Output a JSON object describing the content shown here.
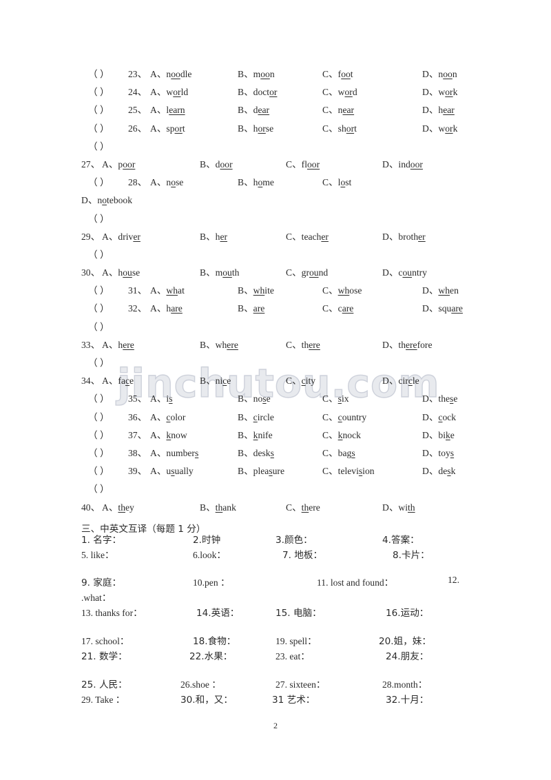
{
  "document": {
    "page_number": "2",
    "watermark": "jinchutou.com"
  },
  "multiple_choice": {
    "rows": [
      {
        "paren": "（      ）",
        "number": "23、",
        "options": [
          {
            "label": "A、",
            "pre": "n",
            "mark": "oo",
            "post": "dle"
          },
          {
            "label": "B、",
            "pre": "m",
            "mark": "oo",
            "post": "n"
          },
          {
            "label": "C、",
            "pre": "f",
            "mark": "oo",
            "post": "t"
          },
          {
            "label": "D、",
            "pre": "n",
            "mark": "oo",
            "post": "n"
          }
        ]
      },
      {
        "paren": "（      ）",
        "number": "24、",
        "options": [
          {
            "label": "A、",
            "pre": "w",
            "mark": "or",
            "post": "ld"
          },
          {
            "label": "B、",
            "pre": "doct",
            "mark": "or",
            "post": ""
          },
          {
            "label": "C、",
            "pre": "w",
            "mark": "or",
            "post": "d"
          },
          {
            "label": "D、",
            "pre": "w",
            "mark": "or",
            "post": "k"
          }
        ]
      },
      {
        "paren": "（      ）",
        "number": "25、",
        "options": [
          {
            "label": "A、",
            "pre": "l",
            "mark": "earn",
            "post": ""
          },
          {
            "label": "B、",
            "pre": "d",
            "mark": "ear",
            "post": ""
          },
          {
            "label": "C、",
            "pre": "n",
            "mark": "ear",
            "post": ""
          },
          {
            "label": "D、",
            "pre": "h",
            "mark": "ear",
            "post": ""
          }
        ]
      },
      {
        "paren": "（      ）",
        "number": "26、",
        "options": [
          {
            "label": "A、",
            "pre": "sp",
            "mark": "or",
            "post": "t"
          },
          {
            "label": "B、",
            "pre": "h",
            "mark": "or",
            "post": "se"
          },
          {
            "label": "C、",
            "pre": "sh",
            "mark": "or",
            "post": "t"
          },
          {
            "label": "D、",
            "pre": "w",
            "mark": "or",
            "post": "k"
          }
        ]
      },
      {
        "paren": "（      ）",
        "number": "27、",
        "wrap_paren": true,
        "options": [
          {
            "label": "A、",
            "pre": "p",
            "mark": "oor",
            "post": ""
          },
          {
            "label": "B、",
            "pre": "d",
            "mark": "oor",
            "post": ""
          },
          {
            "label": "C、",
            "pre": "fl",
            "mark": "oor",
            "post": ""
          },
          {
            "label": "D、",
            "pre": "ind",
            "mark": "oor",
            "post": ""
          }
        ]
      },
      {
        "paren": "（      ）",
        "number": "28、",
        "options": [
          {
            "label": "A、",
            "pre": "n",
            "mark": "o",
            "post": "se"
          },
          {
            "label": "B、",
            "pre": "h",
            "mark": "o",
            "post": "me"
          },
          {
            "label": "C、",
            "pre": "l",
            "mark": "o",
            "post": "st"
          },
          {
            "label": "D、",
            "pre": "n",
            "mark": "o",
            "post": "tebook"
          }
        ]
      },
      {
        "paren": "（      ）",
        "number": "29、",
        "wrap_paren": true,
        "options": [
          {
            "label": "A、",
            "pre": "driv",
            "mark": "er",
            "post": ""
          },
          {
            "label": "B、",
            "pre": "h",
            "mark": "er",
            "post": ""
          },
          {
            "label": "C、",
            "pre": "teach",
            "mark": "er",
            "post": ""
          },
          {
            "label": "D、",
            "pre": "broth",
            "mark": "er",
            "post": ""
          }
        ]
      },
      {
        "paren": "（      ）",
        "number": "30、",
        "wrap_paren": true,
        "options": [
          {
            "label": "A、",
            "pre": "h",
            "mark": "ou",
            "post": "se"
          },
          {
            "label": "B、",
            "pre": "m",
            "mark": "ou",
            "post": "th"
          },
          {
            "label": "C、",
            "pre": "gr",
            "mark": "ou",
            "post": "nd"
          },
          {
            "label": "D、",
            "pre": "c",
            "mark": "ou",
            "post": "ntry"
          }
        ]
      },
      {
        "paren": "（      ）",
        "number": "31、",
        "options": [
          {
            "label": "A、",
            "pre": "",
            "mark": "wh",
            "post": "at"
          },
          {
            "label": "B、",
            "pre": "",
            "mark": "wh",
            "post": "ite"
          },
          {
            "label": "C、",
            "pre": "",
            "mark": "wh",
            "post": "ose"
          },
          {
            "label": "D、",
            "pre": "",
            "mark": "wh",
            "post": "en"
          }
        ]
      },
      {
        "paren": "（      ）",
        "number": "32、",
        "options": [
          {
            "label": "A、",
            "pre": "h",
            "mark": "are",
            "post": ""
          },
          {
            "label": "B、",
            "pre": "",
            "mark": "are",
            "post": ""
          },
          {
            "label": "C、",
            "pre": "c",
            "mark": "are",
            "post": ""
          },
          {
            "label": "D、",
            "pre": "squ",
            "mark": "are",
            "post": ""
          }
        ]
      },
      {
        "paren": "（      ）",
        "number": "33、",
        "wrap_paren": true,
        "options": [
          {
            "label": "A、",
            "pre": "h",
            "mark": "ere",
            "post": ""
          },
          {
            "label": "B、",
            "pre": "wh",
            "mark": "ere",
            "post": ""
          },
          {
            "label": "C、",
            "pre": "th",
            "mark": "ere",
            "post": ""
          },
          {
            "label": "D、",
            "pre": "th",
            "mark": "ere",
            "post": "fore"
          }
        ]
      },
      {
        "paren": "（      ）",
        "number": "34、",
        "wrap_paren": true,
        "options": [
          {
            "label": "A、",
            "pre": "fa",
            "mark": "c",
            "post": "e"
          },
          {
            "label": "B、",
            "pre": "ni",
            "mark": "c",
            "post": "e"
          },
          {
            "label": "C、",
            "pre": "",
            "mark": "c",
            "post": "ity"
          },
          {
            "label": "D、",
            "pre": "cir",
            "mark": "c",
            "post": "le"
          }
        ]
      },
      {
        "paren": "（      ）",
        "number": "35、",
        "options": [
          {
            "label": "A、",
            "pre": "i",
            "mark": "s",
            "post": ""
          },
          {
            "label": "B、",
            "pre": "no",
            "mark": "s",
            "post": "e"
          },
          {
            "label": "C、",
            "pre": "",
            "mark": "s",
            "post": "ix"
          },
          {
            "label": "D、",
            "pre": "the",
            "mark": "s",
            "post": "e"
          }
        ]
      },
      {
        "paren": "（      ）",
        "number": "36、",
        "options": [
          {
            "label": "A、",
            "pre": "",
            "mark": "c",
            "post": "olor"
          },
          {
            "label": "B、",
            "pre": "",
            "mark": "c",
            "post": "ircle"
          },
          {
            "label": "C、",
            "pre": "",
            "mark": "c",
            "post": "ountry"
          },
          {
            "label": "D、",
            "pre": "",
            "mark": "c",
            "post": "ock"
          }
        ]
      },
      {
        "paren": "（      ）",
        "number": "37、",
        "options": [
          {
            "label": "A、",
            "pre": "",
            "mark": "k",
            "post": "now"
          },
          {
            "label": "B、",
            "pre": "",
            "mark": "k",
            "post": "nife"
          },
          {
            "label": "C、",
            "pre": "",
            "mark": "k",
            "post": "nock"
          },
          {
            "label": "D、",
            "pre": "bi",
            "mark": "k",
            "post": "e"
          }
        ]
      },
      {
        "paren": "（      ）",
        "number": "38、",
        "options": [
          {
            "label": "A、",
            "pre": "number",
            "mark": "s",
            "post": ""
          },
          {
            "label": "B、",
            "pre": "desk",
            "mark": "s",
            "post": ""
          },
          {
            "label": "C、",
            "pre": "bag",
            "mark": "s",
            "post": ""
          },
          {
            "label": "D、",
            "pre": "toy",
            "mark": "s",
            "post": ""
          }
        ]
      },
      {
        "paren": "（      ）",
        "number": "39、",
        "options": [
          {
            "label": "A、",
            "pre": "u",
            "mark": "s",
            "post": "ually"
          },
          {
            "label": "B、",
            "pre": "plea",
            "mark": "s",
            "post": "ure"
          },
          {
            "label": "C、",
            "pre": "televi",
            "mark": "s",
            "post": "ion"
          },
          {
            "label": "D、",
            "pre": "de",
            "mark": "s",
            "post": "k"
          }
        ]
      },
      {
        "paren": "（      ）",
        "number": "40、",
        "wrap_paren": true,
        "options": [
          {
            "label": "A、",
            "pre": "",
            "mark": "th",
            "post": "ey"
          },
          {
            "label": "B、",
            "pre": "",
            "mark": "th",
            "post": "ank"
          },
          {
            "label": "C、",
            "pre": "",
            "mark": "th",
            "post": "ere"
          },
          {
            "label": "D、",
            "pre": "wi",
            "mark": "th",
            "post": ""
          }
        ]
      }
    ]
  },
  "translation": {
    "heading": "三、中英文互译（每题 1 分）",
    "items": [
      "1. 名字：",
      "2.时钟",
      "3.颜色：",
      "4.答案：",
      "5. like：",
      "6.look：",
      "7. 地板：",
      "8.卡片：",
      "9. 家庭：",
      "10.pen ：",
      "11. lost and found：",
      "12.",
      ".what：",
      "13. thanks for：",
      "14.英语：",
      "15. 电脑：",
      "16.运动：",
      "17. school：",
      "18.食物：",
      "19. spell：",
      "20.姐，妹：",
      "21. 数学：",
      "22.水果：",
      "23. eat：",
      "24.朋友：",
      "25. 人民：",
      "26.shoe ：",
      "27. sixteen：",
      "28.month：",
      "29. Take ：",
      "30.和，又：",
      "31 艺术：",
      "32.十月："
    ]
  }
}
